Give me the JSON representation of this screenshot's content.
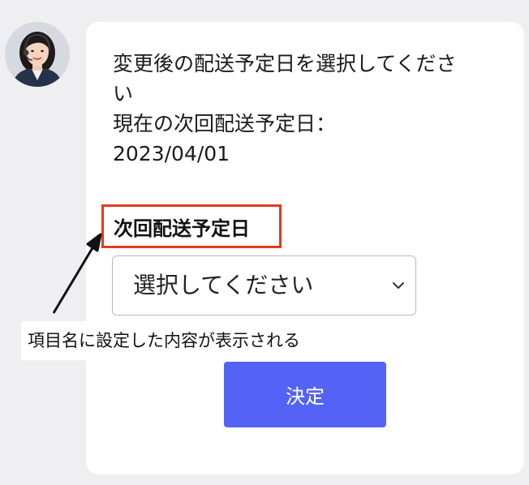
{
  "chat": {
    "message_lines": [
      "変更後の配送予定日を選択してくださ",
      "い",
      "現在の次回配送予定日：",
      "2023/04/01"
    ]
  },
  "form": {
    "field_label": "次回配送予定日",
    "select_value": "選択してください",
    "submit_label": "決定"
  },
  "annotation": {
    "note": "項目名に設定した内容が表示される",
    "highlight_color": "#e03b1f"
  },
  "colors": {
    "button": "#5462f6",
    "background": "#efeff1"
  }
}
